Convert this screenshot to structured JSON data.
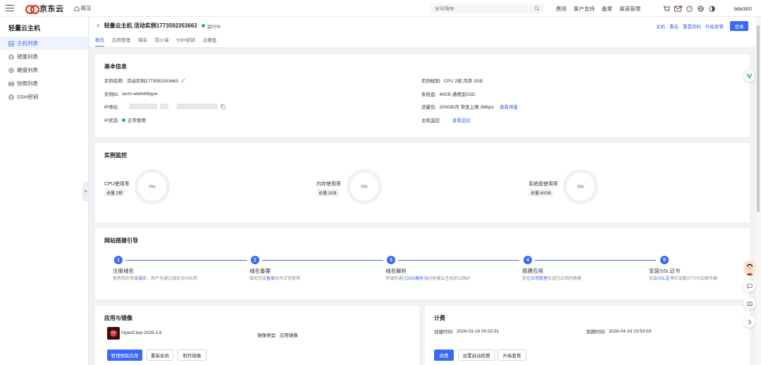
{
  "topbar": {
    "brand": "京东云",
    "overview": "概览",
    "search_placeholder": "全站搜索",
    "nav": [
      "费用",
      "客户支持",
      "备案",
      "渠道管理"
    ],
    "username": "btbt360"
  },
  "sidebar": {
    "title": "轻量云主机",
    "items": [
      {
        "label": "主机列表",
        "active": true
      },
      {
        "label": "镜像列表"
      },
      {
        "label": "硬盘列表"
      },
      {
        "label": "快照列表"
      },
      {
        "label": "SSH密钥"
      }
    ]
  },
  "header": {
    "back": "<",
    "title": "轻量云主机 活动实例1773592353663",
    "status": "运行中",
    "tabs": [
      "概览",
      "应用管理",
      "域名",
      "防火墙",
      "SSH密钥",
      "云硬盘"
    ],
    "actions": [
      "关机",
      "重启",
      "重置密码",
      "升级套餐"
    ],
    "login": "登录"
  },
  "basic": {
    "title": "基本信息",
    "name_k": "实例名称:",
    "name_v": "活动实例1773592353663",
    "id_k": "实例ID:",
    "id_v": "lavm-wtdlnb9qyw",
    "ip_k": "IP地址:",
    "ipstatus_k": "IP状态:",
    "ipstatus_v": "正常使用",
    "spec_k": "实例规则:",
    "spec_v": "CPU 2核  内存 2GB",
    "disk_k": "系统盘:",
    "disk_v": "40GB  通用型SSD",
    "traffic_k": "流量包:",
    "traffic_v": "200GB/月  带宽上限 3Mbps",
    "traffic_link": "查看用量",
    "monitor_k": "主机监控:",
    "monitor_link": "查看监控"
  },
  "monitor": {
    "title": "实例监控",
    "cpu_label": "CPU使用率",
    "cpu_sub": "总量:2核",
    "cpu_val": "0%",
    "cpu_pct": 0,
    "mem_label": "内存使用率",
    "mem_sub": "总量:2GB",
    "mem_val": "0%",
    "mem_pct": 0,
    "disk_label": "系统盘使用率",
    "disk_sub": "总量:40GB",
    "disk_val": "0%",
    "disk_pct": 0
  },
  "guide": {
    "title": "网站搭建引导",
    "steps": [
      {
        "num": "1",
        "title": "注册域名",
        "desc_pre": "拥有你的专属",
        "desc_link": "域名",
        "desc_post": "，用户可通过域名访问应用"
      },
      {
        "num": "2",
        "title": "域名备案",
        "desc_pre": "域名完成",
        "desc_link": "备案",
        "desc_post": "后可正常使用"
      },
      {
        "num": "3",
        "title": "域名解析",
        "desc_pre": "将域名通过",
        "desc_link": "DNS解析",
        "desc_post": "指向轻量云主机的公网IP"
      },
      {
        "num": "4",
        "title": "搭建应用",
        "desc_pre": "前往",
        "desc_link": "应用管理",
        "desc_post": "页进行应用的搭建"
      },
      {
        "num": "5",
        "title": "安装SSL证书",
        "desc_pre": "安装",
        "desc_link": "SSL证书",
        "desc_post": "实现数HTTPS加密传输"
      }
    ]
  },
  "app": {
    "title": "应用与镜像",
    "app_name": "OpenClaw 2026.3.8",
    "image_type_k": "镜像类型:",
    "image_type_v": "应用镜像",
    "buttons": [
      "管理预装应用",
      "重装系统",
      "制作镜像"
    ]
  },
  "billing": {
    "title": "计费",
    "created_k": "创建时间:",
    "created_v": "2026-03-16 00:33:31",
    "expire_k": "到期时间:",
    "expire_v": "2026-04-16 23:59:59",
    "buttons": [
      "续费",
      "设置自动续费",
      "升级套餐"
    ]
  },
  "colors": {
    "accent": "#3768fa",
    "running": "#21b45f",
    "brand_red": "#e1251b"
  }
}
